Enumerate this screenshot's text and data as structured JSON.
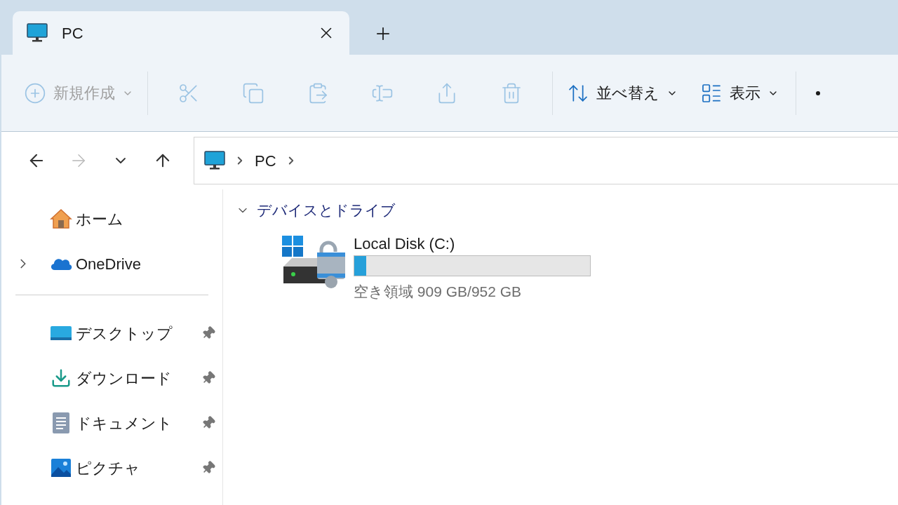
{
  "tabs": [
    {
      "label": "PC",
      "selected": true
    }
  ],
  "toolbar": [
    {
      "kind": "menu",
      "label": "新規作成",
      "disabled": true
    },
    {
      "kind": "icon",
      "disabled": true
    },
    {
      "kind": "icon",
      "disabled": true
    },
    {
      "kind": "icon",
      "disabled": true
    },
    {
      "kind": "icon",
      "disabled": true
    },
    {
      "kind": "icon",
      "disabled": true
    },
    {
      "kind": "icon",
      "disabled": true
    },
    {
      "kind": "menu",
      "label": "並べ替え",
      "disabled": false
    },
    {
      "kind": "menu",
      "label": "表示",
      "disabled": false
    }
  ],
  "navigation": [
    {
      "disabled": false
    },
    {
      "disabled": true
    },
    {
      "disabled": false
    },
    {
      "disabled": false
    }
  ],
  "address": {
    "path": [
      "PC"
    ]
  },
  "sidebar": {
    "items": [
      {
        "label": "ホーム",
        "expandable": false,
        "pinned": false
      },
      {
        "label": "OneDrive",
        "expandable": true,
        "pinned": false
      },
      {
        "label": "デスクトップ",
        "expandable": false,
        "pinned": true
      },
      {
        "label": "ダウンロード",
        "expandable": false,
        "pinned": true
      },
      {
        "label": "ドキュメント",
        "expandable": false,
        "pinned": true
      },
      {
        "label": "ピクチャ",
        "expandable": false,
        "pinned": true
      }
    ]
  },
  "section": {
    "title": "デバイスとドライブ",
    "expanded": true,
    "drives": [
      {
        "name": "Local Disk (C:)",
        "level": 0.05,
        "space": "空き領域 909 GB/952 GB"
      }
    ]
  }
}
